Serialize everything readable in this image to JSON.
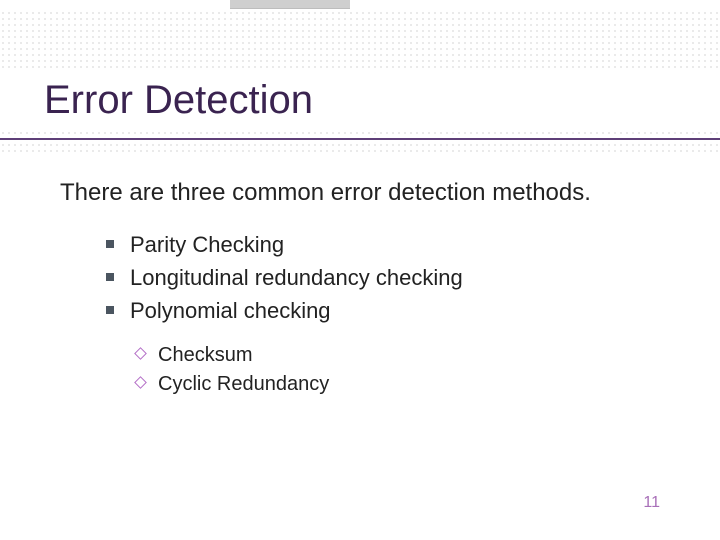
{
  "title": "Error Detection",
  "lead": "There are three common error detection methods.",
  "methods": [
    "Parity Checking",
    "Longitudinal redundancy checking",
    "Polynomial checking"
  ],
  "subitems": [
    "Checksum",
    "Cyclic Redundancy"
  ],
  "page_number": "11"
}
